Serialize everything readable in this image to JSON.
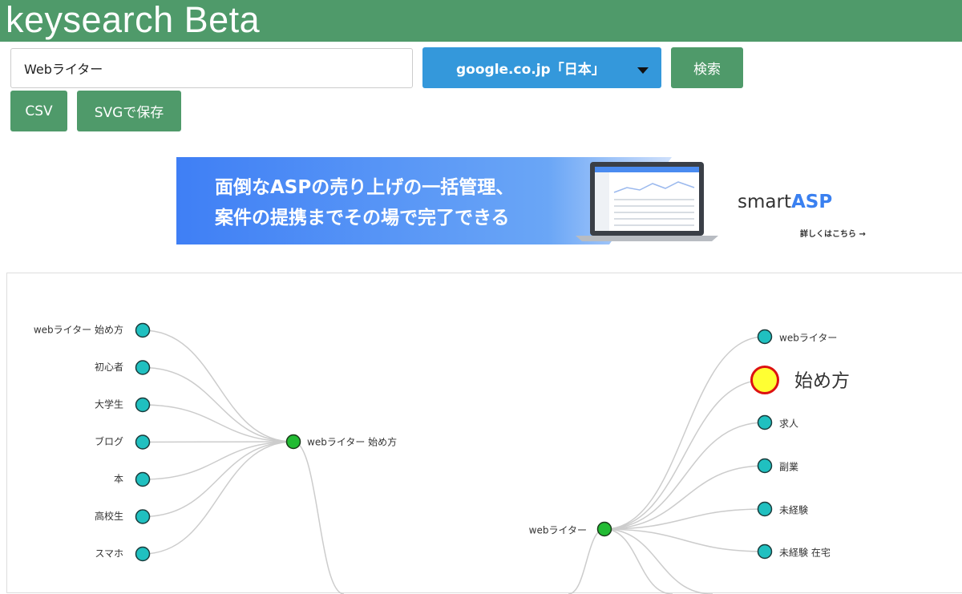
{
  "app": {
    "title": "keysearch Beta"
  },
  "search": {
    "value": "Webライター"
  },
  "region": {
    "label": "google.co.jp「日本」"
  },
  "buttons": {
    "search": "検索",
    "csv": "CSV",
    "svg_save": "SVGで保存"
  },
  "ad": {
    "line1": "面倒なASPの売り上げの一括管理、",
    "line2": "案件の提携までその場で完了できる",
    "brand_prefix": "smart",
    "brand_suffix": "ASP",
    "cta": "詳しくはこちら →"
  },
  "graph": {
    "left_tree": {
      "root": "webライター 始め方",
      "children": [
        "webライター 始め方",
        "初心者",
        "大学生",
        "ブログ",
        "本",
        "高校生",
        "スマホ"
      ]
    },
    "right_tree": {
      "root": "webライター",
      "children": [
        "webライター",
        "始め方",
        "求人",
        "副業",
        "未経験",
        "未経験 在宅"
      ],
      "highlighted": "始め方"
    },
    "colors": {
      "leaf": "#20c0c0",
      "root": "#22bb33",
      "highlight_fill": "#ffff33",
      "highlight_stroke": "#dd1111",
      "link": "#cccccc"
    }
  }
}
